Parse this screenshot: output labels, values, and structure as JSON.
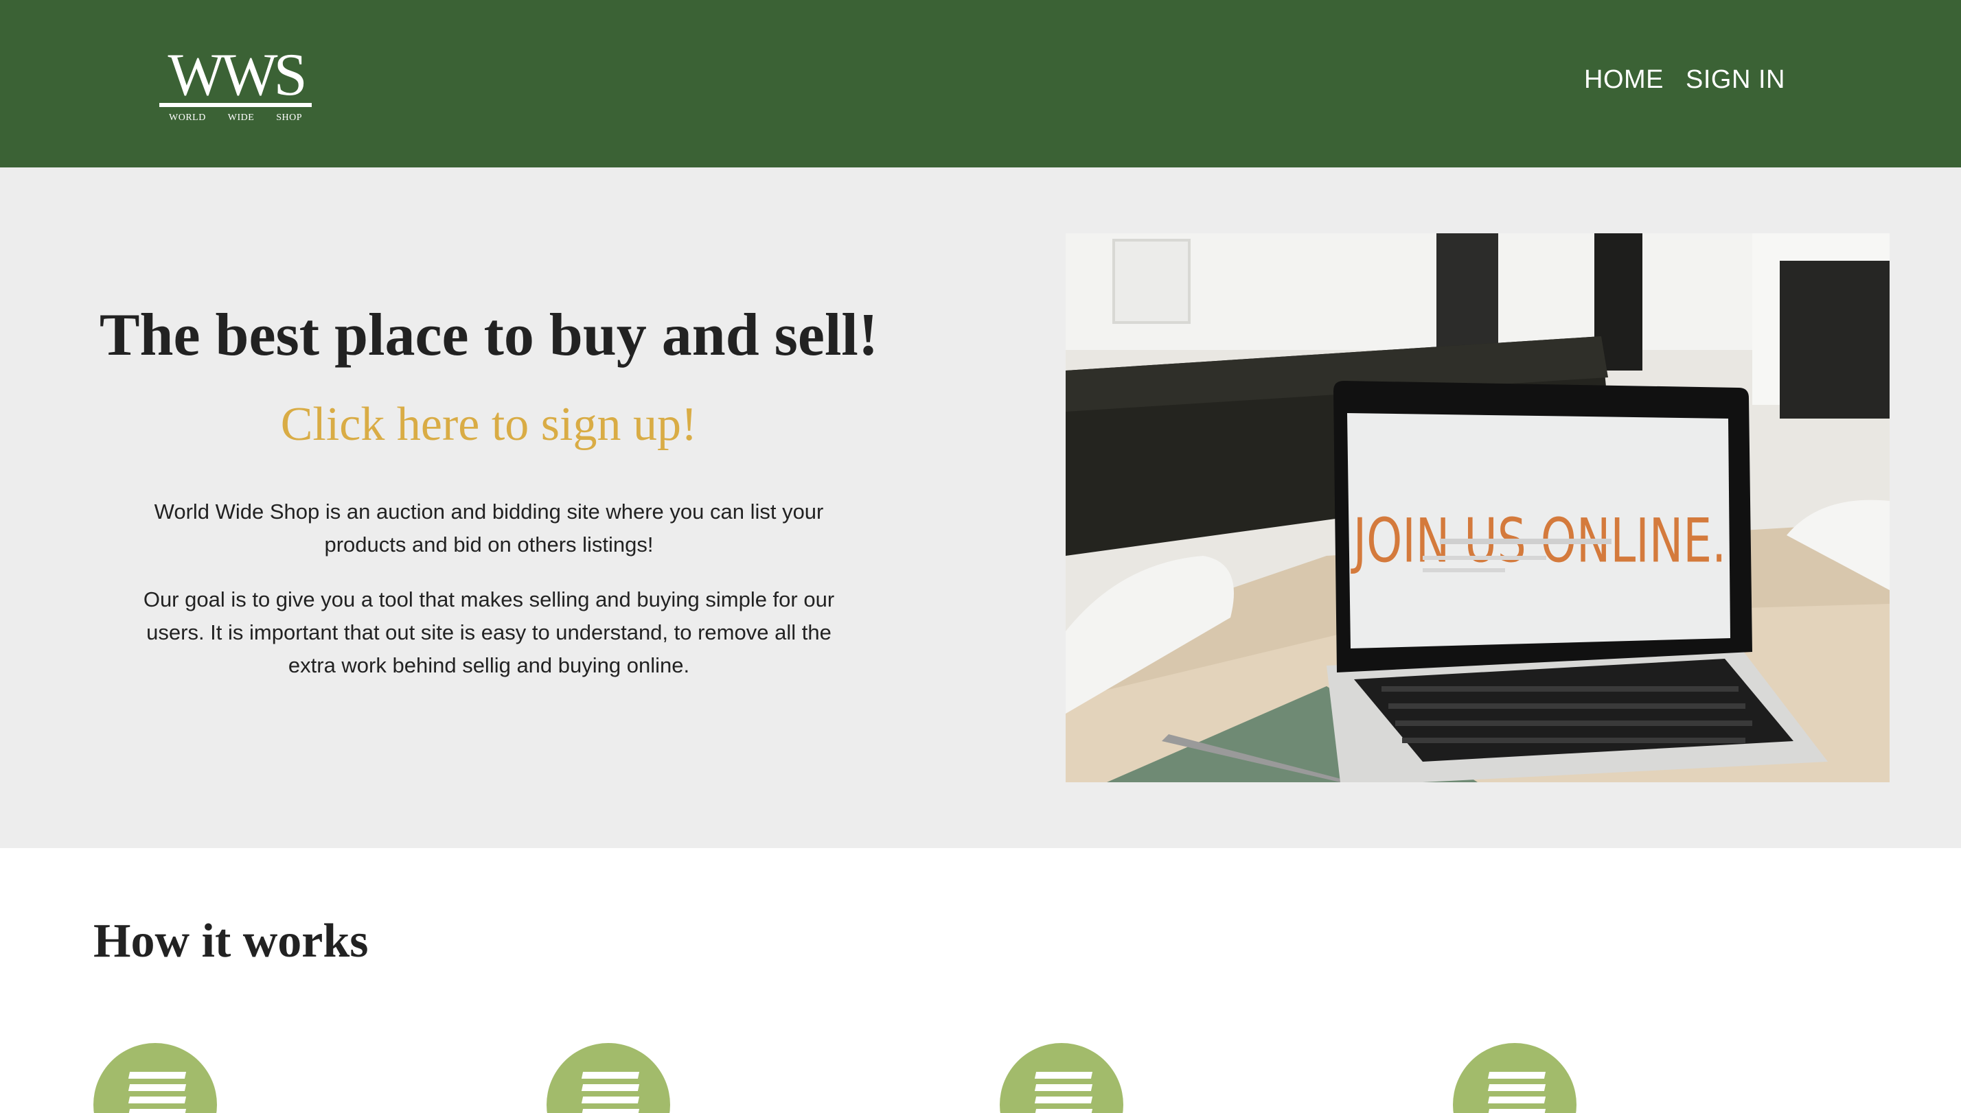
{
  "header": {
    "logo": {
      "mark": "WWS",
      "sub": [
        "WORLD",
        "WIDE",
        "SHOP"
      ]
    },
    "nav": [
      {
        "label": "HOME"
      },
      {
        "label": "SIGN IN"
      }
    ]
  },
  "hero": {
    "title": "The best place to buy and sell!",
    "cta": "Click here to sign up!",
    "paragraphs": [
      "World Wide Shop is an auction and bidding site where you can list your products and bid on others listings!",
      "Our goal is to give you a tool that makes selling and buying simple for our users. It is important that out site is easy to understand, to remove all the extra work behind sellig and buying online."
    ],
    "image": {
      "screen_text": "JOIN US ONLINE."
    }
  },
  "how_it_works": {
    "title": "How it works",
    "steps": [
      {
        "icon": "list-icon"
      },
      {
        "icon": "list-icon"
      },
      {
        "icon": "list-icon"
      },
      {
        "icon": "list-icon"
      }
    ]
  },
  "colors": {
    "header_bg": "#3b6235",
    "hero_bg": "#ededed",
    "cta": "#d9ac45",
    "step_icon_bg": "#a2bb6b"
  }
}
